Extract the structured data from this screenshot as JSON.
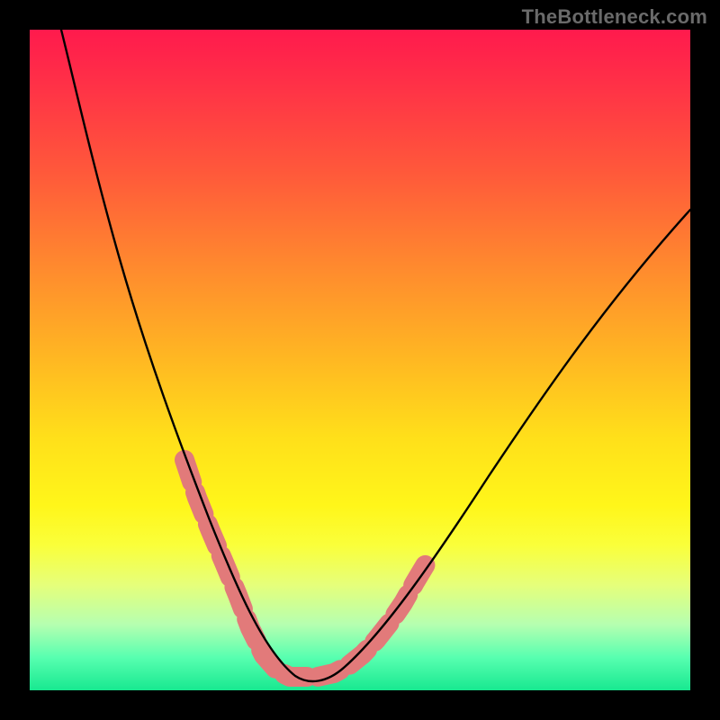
{
  "watermark": {
    "text": "TheBottleneck.com"
  },
  "chart_data": {
    "type": "line",
    "title": "",
    "xlabel": "",
    "ylabel": "",
    "xlim": [
      0,
      100
    ],
    "ylim": [
      0,
      100
    ],
    "grid": false,
    "legend": false,
    "series": [
      {
        "name": "curve",
        "color": "#000000",
        "x": [
          5,
          10,
          15,
          20,
          25,
          28,
          30,
          32,
          34,
          36,
          38,
          40,
          45,
          50,
          55,
          60,
          65,
          70,
          75,
          80,
          85,
          90,
          95,
          100
        ],
        "y": [
          100,
          83,
          65,
          48,
          33,
          24,
          19,
          14,
          9,
          5,
          3,
          2,
          2,
          6,
          13,
          21,
          29,
          37,
          44,
          51,
          57,
          63,
          68,
          73
        ]
      },
      {
        "name": "highlight-overlay",
        "color": "#e27a7a",
        "x": [
          24,
          26,
          28,
          30,
          32,
          34,
          36,
          38,
          40,
          42,
          44,
          46,
          48,
          50,
          52,
          54,
          56,
          58
        ],
        "y": [
          35,
          29,
          24,
          19,
          14,
          9,
          5,
          3,
          2,
          2,
          2,
          3,
          5,
          7,
          10,
          13,
          17,
          20
        ]
      }
    ],
    "background_gradient": {
      "stops": [
        {
          "pos": 0,
          "color": "#ff1a4d"
        },
        {
          "pos": 50,
          "color": "#ffb822"
        },
        {
          "pos": 75,
          "color": "#fff61a"
        },
        {
          "pos": 100,
          "color": "#18e890"
        }
      ]
    }
  }
}
